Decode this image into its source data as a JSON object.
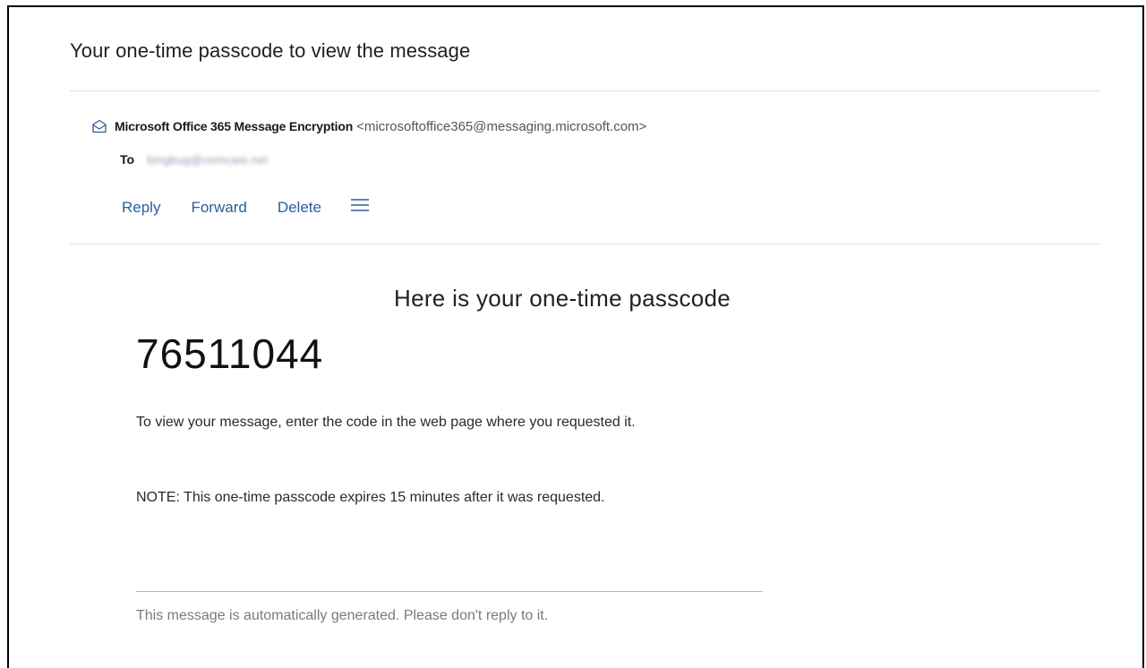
{
  "email": {
    "subject": "Your one-time passcode to view the message",
    "sender": {
      "name": "Microsoft Office 365 Message Encryption",
      "address": "<microsoftoffice365@messaging.microsoft.com>"
    },
    "recipient": {
      "label": "To",
      "address": "bingbug@comcast.net"
    },
    "actions": {
      "reply": "Reply",
      "forward": "Forward",
      "delete": "Delete",
      "more_icon": "hamburger-menu-icon"
    }
  },
  "content": {
    "heading": "Here is your one-time passcode",
    "passcode": "76511044",
    "instruction": "To view your message, enter the code in the web page where you requested it.",
    "note": "NOTE: This one-time passcode expires 15 minutes after it was requested.",
    "footer": "This message is automatically generated. Please don't reply to it."
  },
  "colors": {
    "link": "#2b5f99",
    "divider": "#e1e1e1",
    "footer_text": "#7a7a7a"
  }
}
